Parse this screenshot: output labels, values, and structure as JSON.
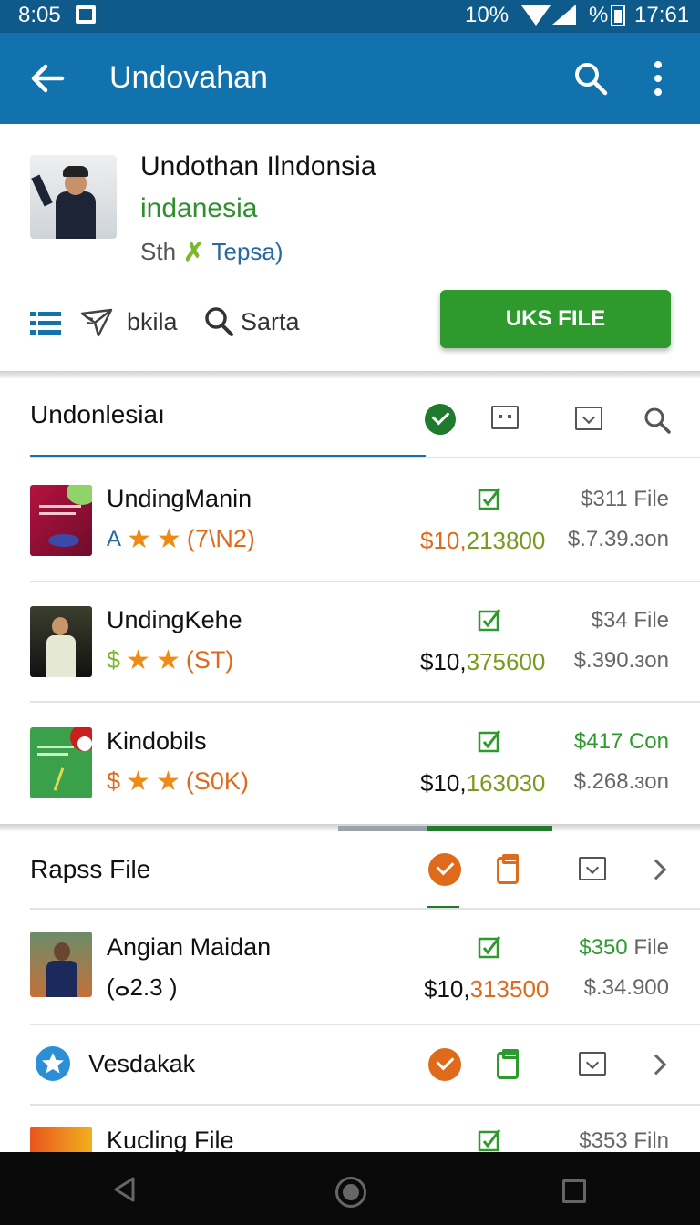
{
  "status_bar": {
    "time": "8:05",
    "battery_percent": "10%",
    "percent_symbol": "%",
    "clock": "17:61"
  },
  "app_bar": {
    "title": "Undovahan"
  },
  "profile": {
    "name": "Undothan Ilndonsia",
    "country": "indanesia",
    "meta_label": "Sth",
    "meta_link": "Tepsa)",
    "actions": {
      "bkila": "bkila",
      "sarta": "Sarta",
      "primary_button": "UKS FILE"
    }
  },
  "section1": {
    "title": "Undonlesiaı",
    "rows": [
      {
        "title": "UndingManin",
        "prefix": "A",
        "rating_text": "(7\\N2)",
        "price_main": "$10,",
        "price_tail": "213800",
        "right_top": "$311 File",
        "right_bottom": "$.7.39.ɜon"
      },
      {
        "title": "UndingKehe",
        "prefix": "$",
        "rating_text": "(ST)",
        "price_main": "$10,",
        "price_tail": "375600",
        "right_top": "$34 File",
        "right_bottom": "$.390.ɜon"
      },
      {
        "title": "Kindobils",
        "prefix": "$",
        "rating_text": "(S0K)",
        "price_main": "$10,",
        "price_tail": "163030",
        "right_top": "$417 Con",
        "right_bottom": "$.268.ɜon"
      }
    ]
  },
  "section2": {
    "title": "Rapss File",
    "rows": [
      {
        "title": "Angian Maidan",
        "sub": "(ⴰ2.3 )",
        "price_main": "$10,",
        "price_tail": "313500",
        "right_top_price": "$350",
        "right_top_word": " File",
        "right_bottom": "$.34.900"
      }
    ],
    "item_vesdakak": "Vesdakak",
    "partial_row": {
      "title": "Kucling File",
      "right_top": "$353 Filn"
    }
  },
  "colors": {
    "app_bar": "#1172ad",
    "status_bar": "#0e5a8a",
    "primary_green": "#2e9a2e",
    "star_orange": "#f08a12",
    "accent_orange": "#e06a1b"
  },
  "icons": [
    "back-arrow-icon",
    "search-icon",
    "more-vert-icon",
    "list-icon",
    "send-icon",
    "check-circle-icon",
    "edit-check-icon",
    "clipboard-icon",
    "download-box-icon",
    "chevron-right-icon",
    "star-badge-icon"
  ]
}
